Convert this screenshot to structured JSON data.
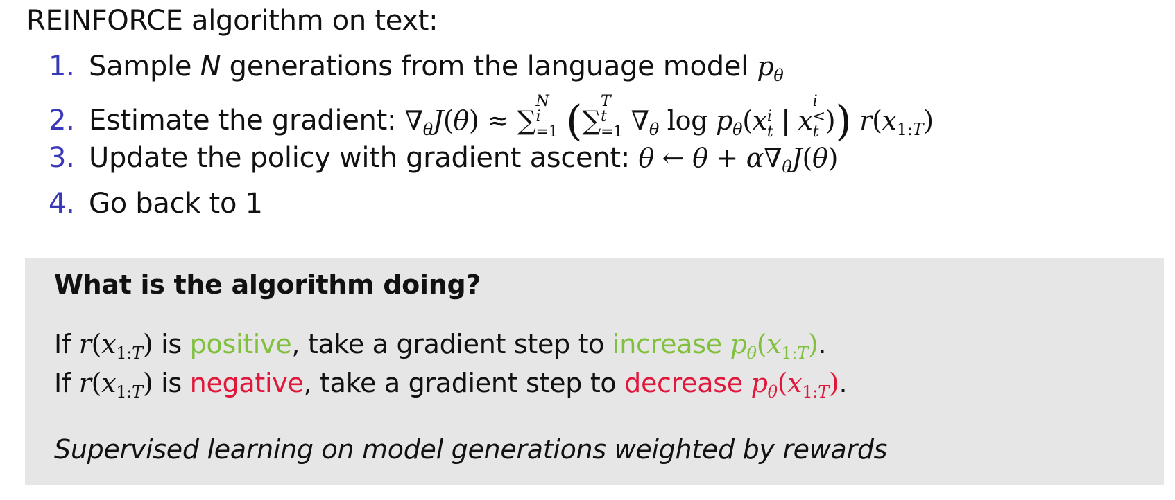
{
  "heading": "REINFORCE algorithm on text:",
  "steps": [
    {
      "num": "1.",
      "text": "Sample",
      "N": "N",
      "text2": "generations from the language model",
      "p": "p",
      "theta": "θ"
    },
    {
      "num": "2.",
      "text": "Estimate the gradient:"
    },
    {
      "num": "3.",
      "text": "Update the policy with gradient ascent:"
    },
    {
      "num": "4.",
      "text": "Go back to 1"
    }
  ],
  "box": {
    "title": "What is the algorithm doing?",
    "if_word": "If",
    "is_word": "is",
    "positive": "positive",
    "negative": "negative",
    "take_step": ", take a gradient step to",
    "increase": "increase",
    "decrease": "decrease",
    "note": "Supervised learning on model generations weighted by rewards"
  },
  "colors": {
    "number": "#3838b8",
    "positive": "#80c03c",
    "negative": "#e0183c",
    "box_bg": "#e6e6e6"
  }
}
